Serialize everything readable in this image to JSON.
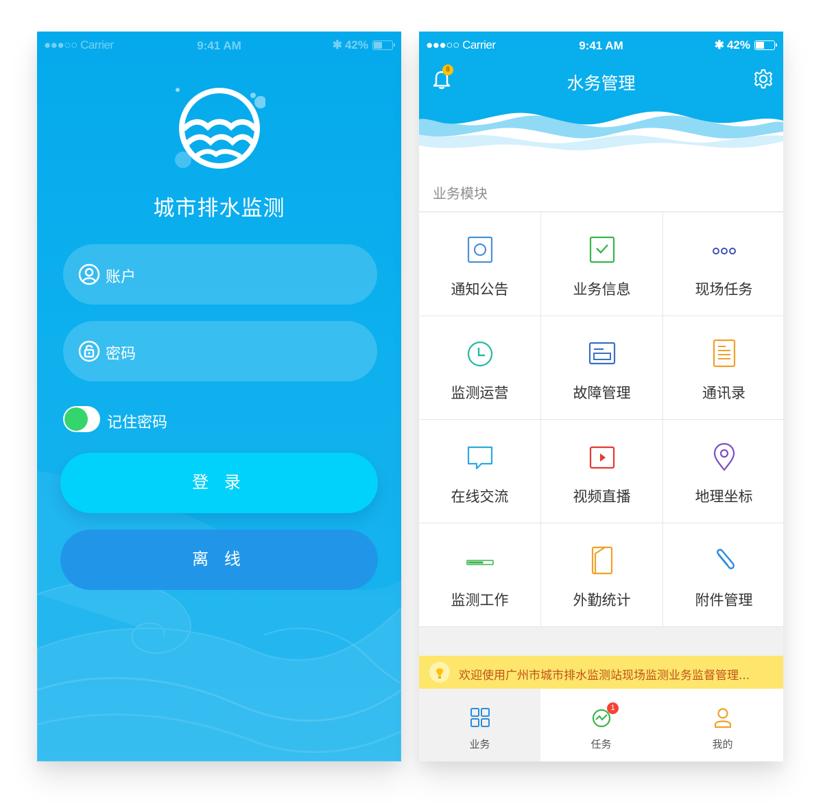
{
  "status_bar": {
    "carrier": "●●●○○ Carrier",
    "time": "9:41 AM",
    "battery": "42%",
    "battery_level": 0.42
  },
  "login": {
    "app_title": "城市排水监测",
    "account_placeholder": "账户",
    "password_placeholder": "密码",
    "remember_label": "记住密码",
    "remember_on": true,
    "login_button": "登 录",
    "offline_button": "离 线"
  },
  "main": {
    "header_title": "水务管理",
    "bell_badge": "8",
    "section_title": "业务模块",
    "modules": [
      {
        "label": "通知公告",
        "icon": "notice-icon"
      },
      {
        "label": "业务信息",
        "icon": "check-doc-icon"
      },
      {
        "label": "现场任务",
        "icon": "more-dots-icon"
      },
      {
        "label": "监测运营",
        "icon": "clock-icon"
      },
      {
        "label": "故障管理",
        "icon": "card-icon"
      },
      {
        "label": "通讯录",
        "icon": "contacts-icon"
      },
      {
        "label": "在线交流",
        "icon": "chat-icon"
      },
      {
        "label": "视频直播",
        "icon": "video-icon"
      },
      {
        "label": "地理坐标",
        "icon": "location-pin-icon"
      },
      {
        "label": "监测工作",
        "icon": "progress-icon"
      },
      {
        "label": "外勤统计",
        "icon": "door-icon"
      },
      {
        "label": "附件管理",
        "icon": "paperclip-icon"
      }
    ],
    "notice_text": "欢迎使用广州市城市排水监测站现场监测业务监督管理...",
    "tabs": [
      {
        "label": "业务",
        "icon": "grid-icon",
        "active": true
      },
      {
        "label": "任务",
        "icon": "task-icon",
        "badge": "1"
      },
      {
        "label": "我的",
        "icon": "user-icon"
      }
    ]
  },
  "colors": {
    "login_bg": "#0aaeed",
    "header_bg": "#09aeec",
    "login_button": "#00d2fb",
    "offline_button": "#2196e8",
    "toggle_on": "#35d56e",
    "notice_bg": "#fde66b",
    "notice_text": "#c0541c"
  }
}
